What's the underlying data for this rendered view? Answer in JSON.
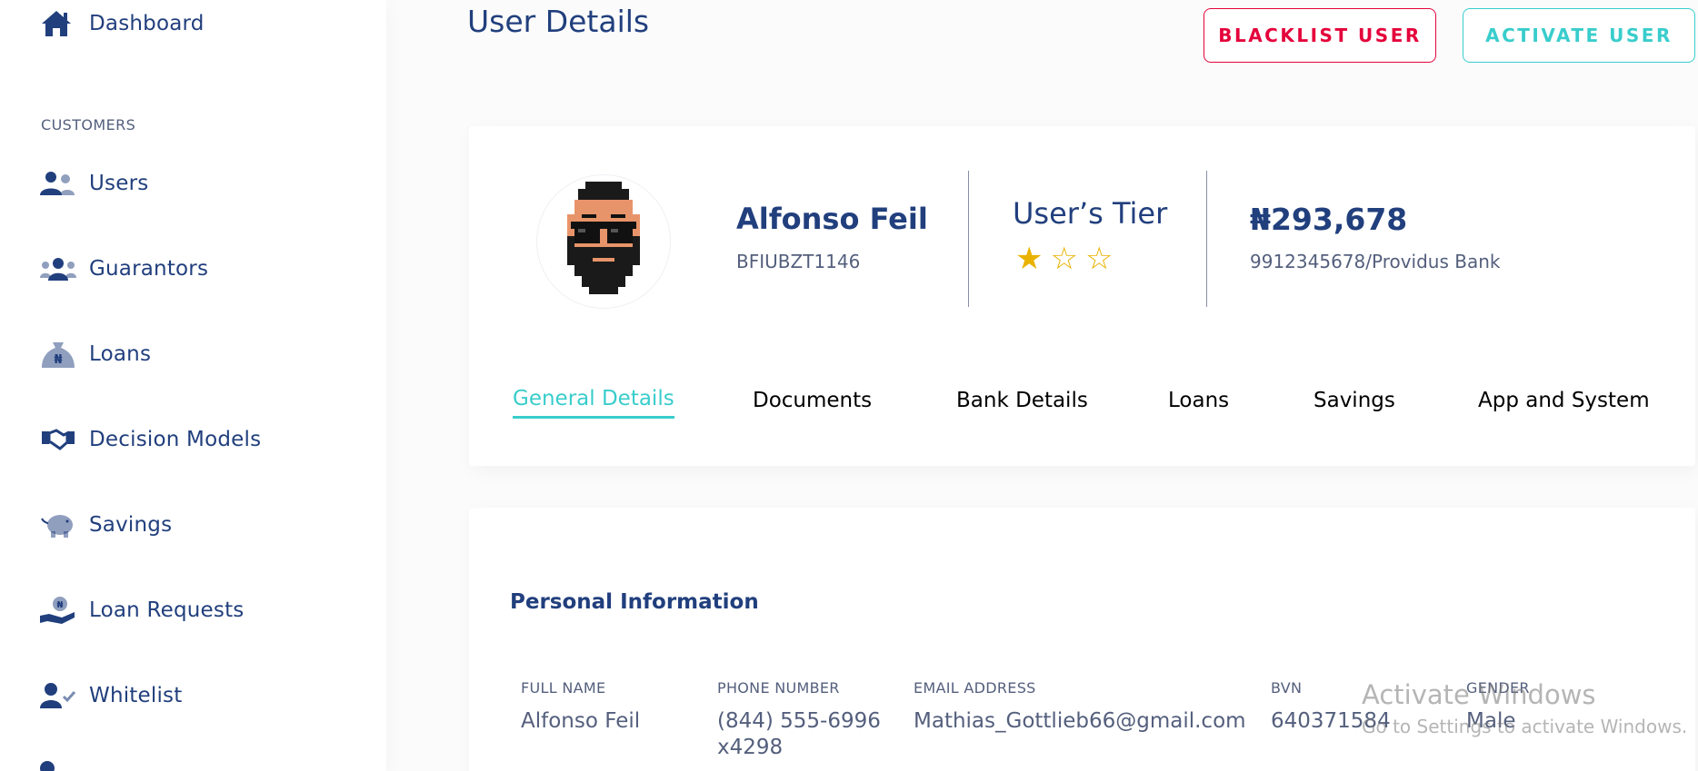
{
  "sidebar": {
    "dashboard_label": "Dashboard",
    "section_customers": "CUSTOMERS",
    "items": [
      {
        "label": "Users",
        "icon": "users-icon"
      },
      {
        "label": "Guarantors",
        "icon": "guarantors-icon"
      },
      {
        "label": "Loans",
        "icon": "loans-icon"
      },
      {
        "label": "Decision Models",
        "icon": "handshake-icon"
      },
      {
        "label": "Savings",
        "icon": "piggy-bank-icon"
      },
      {
        "label": "Loan Requests",
        "icon": "loan-request-icon"
      },
      {
        "label": "Whitelist",
        "icon": "user-check-icon"
      }
    ]
  },
  "header": {
    "title": "User Details",
    "blacklist_label": "BLACKLIST USER",
    "activate_label": "ACTIVATE USER"
  },
  "profile": {
    "name": "Alfonso Feil",
    "user_id": "BFIUBZT1146",
    "tier_title": "User’s Tier",
    "tier_stars_filled": 1,
    "tier_stars_total": 3,
    "balance": "₦293,678",
    "account": "9912345678/Providus Bank"
  },
  "tabs": [
    {
      "label": "General Details",
      "active": true
    },
    {
      "label": "Documents",
      "active": false
    },
    {
      "label": "Bank Details",
      "active": false
    },
    {
      "label": "Loans",
      "active": false
    },
    {
      "label": "Savings",
      "active": false
    },
    {
      "label": "App and System",
      "active": false
    }
  ],
  "personal": {
    "title": "Personal Information",
    "fields": [
      {
        "label": "FULL NAME",
        "value": "Alfonso Feil"
      },
      {
        "label": "PHONE NUMBER",
        "value_line1": "(844) 555-6996",
        "value_line2": "x4298"
      },
      {
        "label": "EMAIL ADDRESS",
        "value": "Mathias_Gottlieb66@gmail.com"
      },
      {
        "label": "BVN",
        "value": "640371584"
      },
      {
        "label": "GENDER",
        "value": "Male"
      }
    ]
  },
  "watermark": {
    "line1": "Activate Windows",
    "line2": "Go to Settings to activate Windows."
  },
  "colors": {
    "primary": "#213f7d",
    "accent": "#39cdcc",
    "danger": "#e4033b",
    "star": "#e9b200",
    "muted": "#545f7d"
  }
}
